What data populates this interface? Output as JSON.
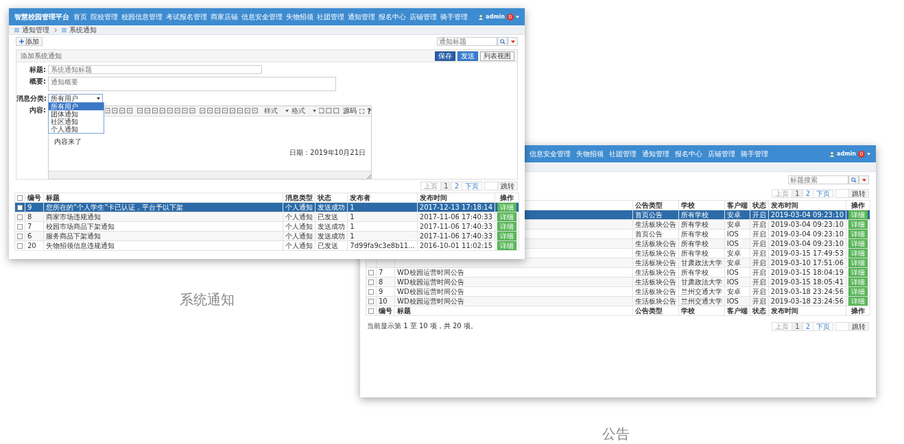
{
  "notification_window": {
    "app_title": "智慧校园管理平台",
    "nav": [
      "首页",
      "院校管理",
      "校园信息管理",
      "考试报名管理",
      "商家店铺",
      "信息安全管理",
      "失物招领",
      "社团管理",
      "通知管理",
      "报名中心",
      "店铺管理",
      "骑手管理"
    ],
    "user": {
      "name": "admin",
      "badge": "0"
    },
    "breadcrumb": [
      "通知管理",
      "系统通知"
    ],
    "add_button": "添加",
    "search": {
      "placeholder": "通知标题"
    },
    "panel_title": "添加系统通知",
    "panel_buttons": [
      {
        "label": "保存",
        "kind": "primary"
      },
      {
        "label": "发送",
        "kind": "info"
      },
      {
        "label": "列表视图",
        "kind": "default"
      }
    ],
    "form": {
      "title_label": "标题:",
      "title_placeholder": "系统通知标题",
      "summary_label": "概要:",
      "summary_placeholder": "通知概要",
      "category_label": "消息分类:",
      "category_value": "所有用户",
      "category_options": [
        {
          "label": "所有用户",
          "selected": true
        },
        {
          "label": "团体通知",
          "selected": false
        },
        {
          "label": "社区通知",
          "selected": false
        },
        {
          "label": "个人通知",
          "selected": false
        }
      ],
      "content_label": "内容:",
      "editor": {
        "toolbar": [
          "样式",
          "格式",
          "源码",
          "?"
        ],
        "lines": [
          "内容来了"
        ],
        "date": "日期：2019年10月21日"
      }
    },
    "pagination": {
      "prev": "上页",
      "pages": [
        {
          "label": "1",
          "selected": true
        },
        {
          "label": "2",
          "selected": false
        }
      ],
      "next": "下页",
      "jump": "跳转"
    },
    "table": {
      "select_all_checked": false,
      "columns": [
        "编号",
        "标题",
        "消息类型",
        "状态",
        "发布者",
        "发布时间",
        "操作"
      ],
      "rows": [
        {
          "no": "9",
          "title": "您所在的“个人学生”卡已认证，平台予以下架",
          "type": "个人通知",
          "status": "发送成功",
          "publisher": "1",
          "time": "2017-12-13 17:18:14",
          "action": "详细",
          "selected": true
        },
        {
          "no": "8",
          "title": "商家市场违规通知",
          "type": "个人通知",
          "status": "已发送",
          "publisher": "1",
          "time": "2017-11-06 17:40:33",
          "action": "详细",
          "selected": false
        },
        {
          "no": "7",
          "title": "校园市场商品下架通知",
          "type": "个人通知",
          "status": "发送成功",
          "publisher": "1",
          "time": "2017-11-06 17:40:33",
          "action": "详细",
          "selected": false
        },
        {
          "no": "6",
          "title": "服务商品下架通知",
          "type": "个人通知",
          "status": "发送成功",
          "publisher": "1",
          "time": "2017-11-06 17:40:33",
          "action": "详细",
          "selected": false
        },
        {
          "no": "20",
          "title": "失物招领信息违规通知",
          "type": "个人通知",
          "status": "已发送",
          "publisher": "7d99fa9c3e8b11...",
          "time": "2016-10-01 11:02:15",
          "action": "详细",
          "selected": false
        }
      ]
    },
    "caption": "系统通知"
  },
  "announcement_window": {
    "nav": [
      "信息安全管理",
      "失物招领",
      "社团管理",
      "通知管理",
      "报名中心",
      "店铺管理",
      "骑手管理"
    ],
    "user": {
      "name": "admin",
      "badge": "0"
    },
    "search": {
      "placeholder": "标题搜索"
    },
    "pagination": {
      "prev": "上页",
      "pages": [
        {
          "label": "1",
          "selected": true
        },
        {
          "label": "2",
          "selected": false
        }
      ],
      "next": "下页",
      "jump": "跳转"
    },
    "table": {
      "columns": [
        "公告类型",
        "学校",
        "客户端",
        "状态",
        "发布时间",
        "操作"
      ],
      "rows": [
        {
          "type": "首页公告",
          "school": "所有学校",
          "client": "安卓",
          "status": "开启",
          "time": "2019-03-04 09:23:10",
          "action": "详细",
          "selected": true
        },
        {
          "type": "生活板块公告",
          "school": "所有学校",
          "client": "安卓",
          "status": "开启",
          "time": "2019-03-04 09:23:10",
          "action": "详细",
          "selected": false
        },
        {
          "type": "首页公告",
          "school": "所有学校",
          "client": "IOS",
          "status": "开启",
          "time": "2019-03-04 09:23:10",
          "action": "详细",
          "selected": false
        },
        {
          "type": "生活板块公告",
          "school": "所有学校",
          "client": "IOS",
          "status": "开启",
          "time": "2019-03-04 09:23:10",
          "action": "详细",
          "selected": false
        },
        {
          "type": "生活板块公告",
          "school": "所有学校",
          "client": "安卓",
          "status": "开启",
          "time": "2019-03-15 17:49:53",
          "action": "详细",
          "selected": false
        },
        {
          "type": "生活板块公告",
          "school": "甘肃政法大学",
          "client": "安卓",
          "status": "开启",
          "time": "2019-03-10 17:51:06",
          "action": "详细",
          "selected": false
        },
        {
          "no": "7",
          "title": "WD校园运营时间公告",
          "type": "生活板块公告",
          "school": "所有学校",
          "client": "IOS",
          "status": "开启",
          "time": "2019-03-15 18:04:19",
          "action": "详细",
          "selected": false
        },
        {
          "no": "8",
          "title": "WD校园运营时间公告",
          "type": "生活板块公告",
          "school": "甘肃政法大学",
          "client": "IOS",
          "status": "开启",
          "time": "2019-03-15 18:05:41",
          "action": "详细",
          "selected": false
        },
        {
          "no": "9",
          "title": "WD校园运营时间公告",
          "type": "生活板块公告",
          "school": "兰州交通大学",
          "client": "安卓",
          "status": "开启",
          "time": "2019-03-18 23:24:56",
          "action": "详细",
          "selected": false
        },
        {
          "no": "10",
          "title": "WD校园运营时间公告",
          "type": "生活板块公告",
          "school": "兰州交通大学",
          "client": "IOS",
          "status": "开启",
          "time": "2019-03-18 23:24:56",
          "action": "详细",
          "selected": false
        }
      ],
      "select_all_checked": false,
      "footer_columns": [
        "编号",
        "标题",
        "公告类型",
        "学校",
        "客户端",
        "状态",
        "发布时间",
        "操作"
      ]
    },
    "bottom_pagination": {
      "prev": "上页",
      "pages": [
        {
          "label": "1",
          "selected": true
        },
        {
          "label": "2",
          "selected": false
        }
      ],
      "next": "下页",
      "jump": "跳转"
    },
    "info": "当前显示第 1 至 10 项，共 20 项。",
    "caption": "公告"
  }
}
